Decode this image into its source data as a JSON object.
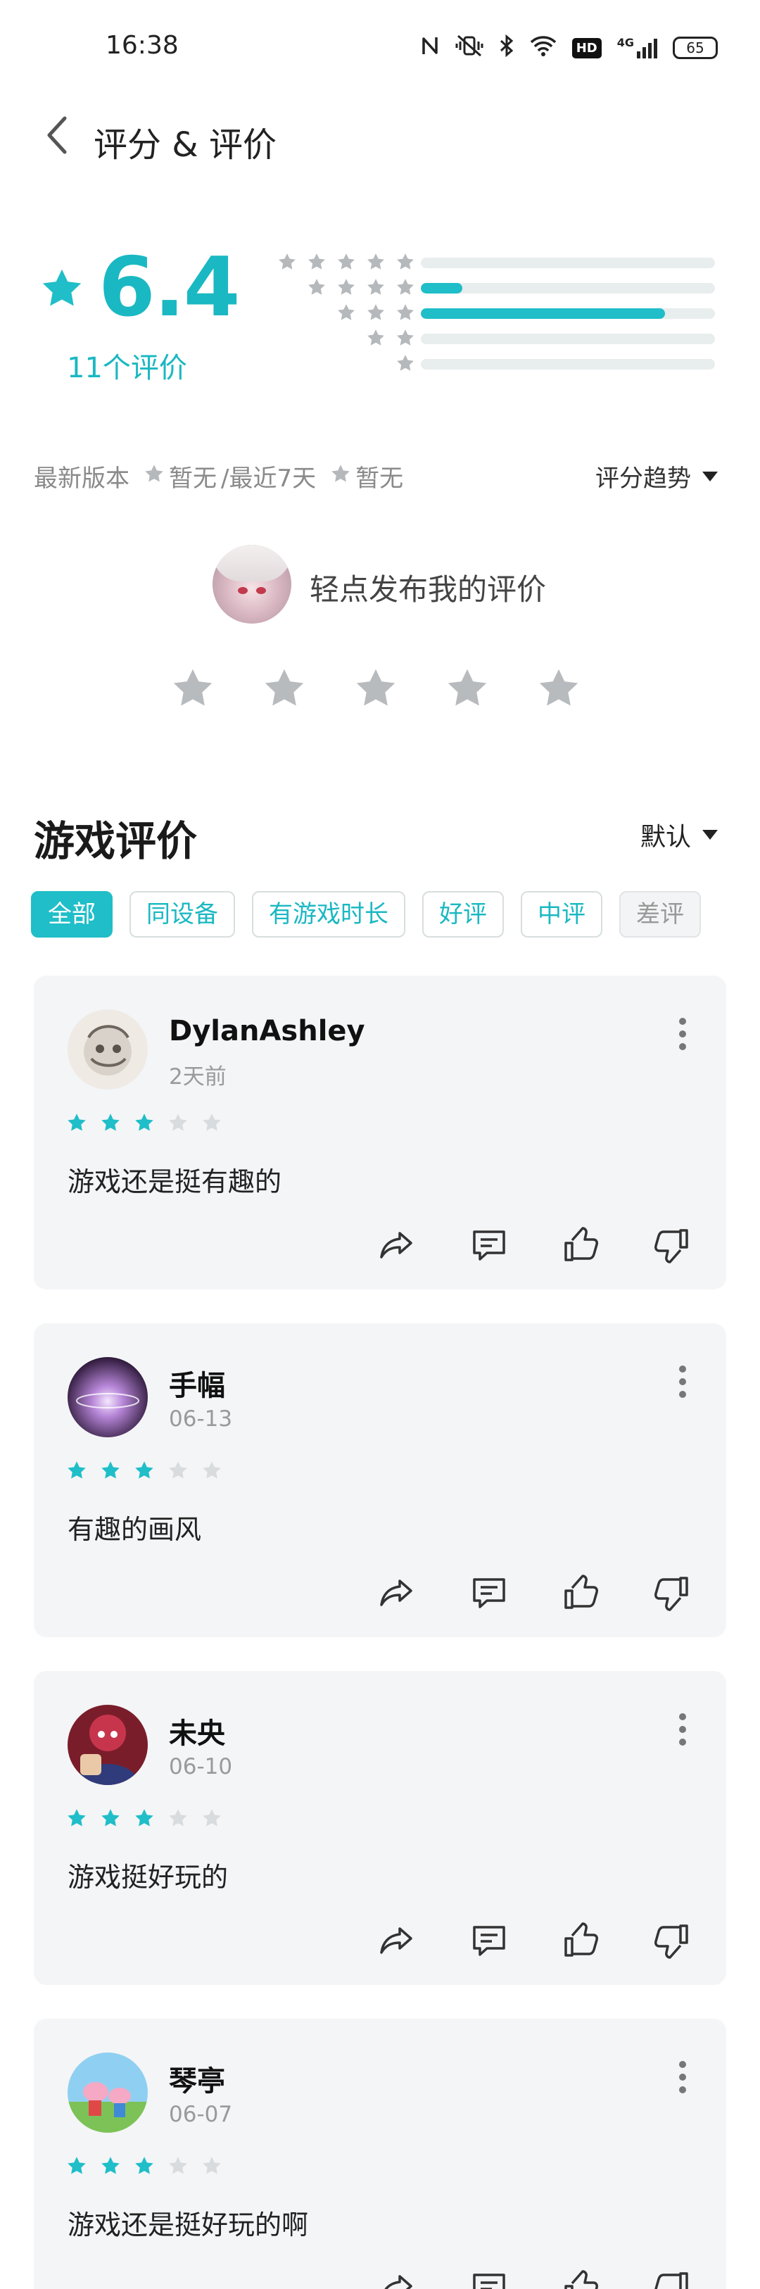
{
  "status_bar": {
    "time": "16:38",
    "icons": [
      "nfc-icon",
      "vibrate-icon",
      "bluetooth-icon",
      "wifi-icon",
      "hd-icon",
      "signal-4g-icon"
    ],
    "hd_label": "HD",
    "network_label": "4G",
    "battery": "65"
  },
  "header": {
    "title": "评分 & 评价"
  },
  "rating": {
    "score": "6.4",
    "count_label": "11个评价",
    "distribution": [
      {
        "stars": 5,
        "fraction": 0.0
      },
      {
        "stars": 4,
        "fraction": 0.14
      },
      {
        "stars": 3,
        "fraction": 0.83
      },
      {
        "stars": 2,
        "fraction": 0.0
      },
      {
        "stars": 1,
        "fraction": 0.0
      }
    ],
    "latest_version_label": "最新版本",
    "latest_version_value": "暂无",
    "separator": "/最近7天",
    "recent_value": "暂无",
    "trend_label": "评分趋势"
  },
  "my_review": {
    "prompt": "轻点发布我的评价",
    "star_count": 5
  },
  "reviews_section": {
    "title": "游戏评价",
    "sort_label": "默认",
    "filters": [
      {
        "label": "全部",
        "state": "active"
      },
      {
        "label": "同设备",
        "state": "normal"
      },
      {
        "label": "有游戏时长",
        "state": "normal"
      },
      {
        "label": "好评",
        "state": "normal"
      },
      {
        "label": "中评",
        "state": "normal"
      },
      {
        "label": "差评",
        "state": "muted"
      }
    ]
  },
  "reviews": [
    {
      "user": "DylanAshley",
      "date": "2天前",
      "stars": 3,
      "text": "游戏还是挺有趣的",
      "avatar": "sketch-face"
    },
    {
      "user": "手幅",
      "date": "06-13",
      "stars": 3,
      "text": "有趣的画风",
      "avatar": "purple-glow"
    },
    {
      "user": "未央",
      "date": "06-10",
      "stars": 3,
      "text": "游戏挺好玩的",
      "avatar": "red-anime"
    },
    {
      "user": "琴亭",
      "date": "06-07",
      "stars": 3,
      "text": "游戏还是挺好玩的啊",
      "avatar": "peppa-pig"
    }
  ],
  "colors": {
    "accent": "#1fbec8",
    "star_filled": "#1fbec8",
    "star_empty": "#d9dcde",
    "card_bg": "#f4f5f7"
  }
}
